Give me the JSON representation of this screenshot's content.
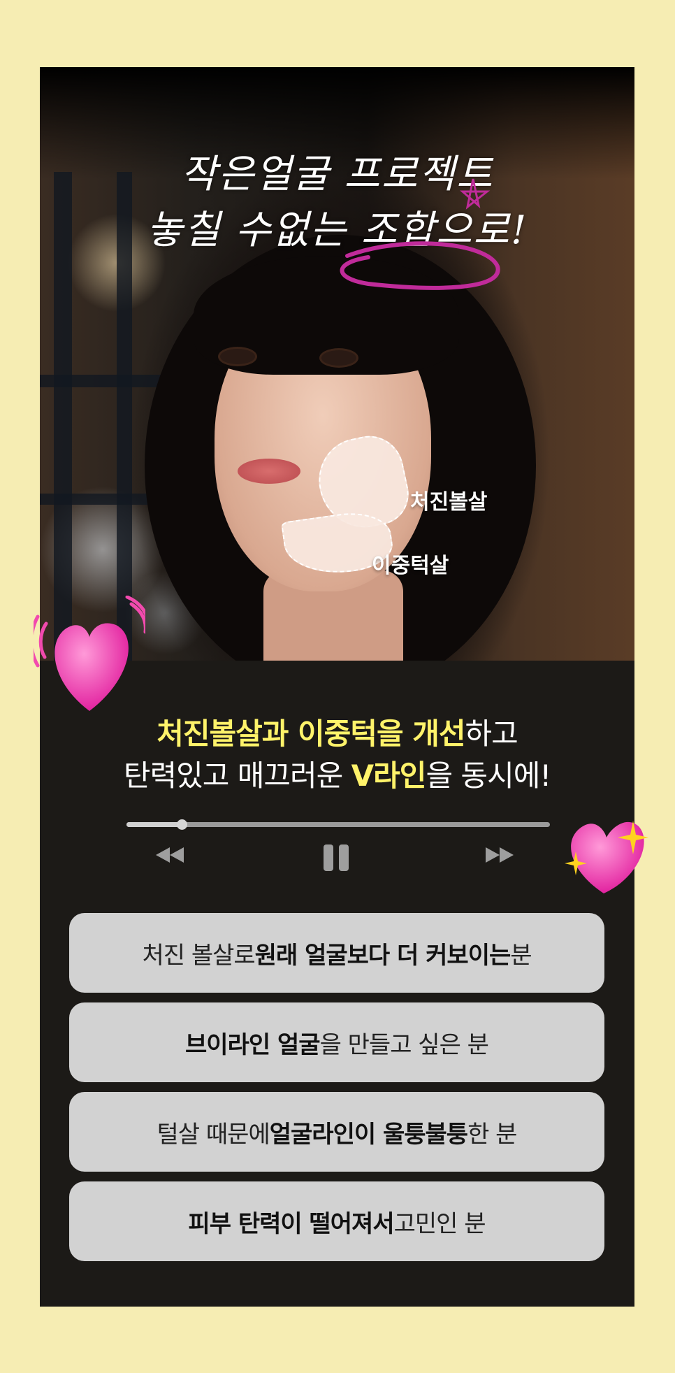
{
  "hero": {
    "title_line1": "작은얼굴 프로젝트",
    "title_line2": "놓칠 수없는 조합으로!",
    "label_cheek": "처진볼살",
    "label_chin": "이중턱살"
  },
  "headline": {
    "line1_hl": "처진볼살과 이중턱을 개선",
    "line1_rest": "하고",
    "line2_a": "탄력있고 매끄러운 ",
    "line2_hl": "V라인",
    "line2_b": "을 동시에!"
  },
  "player": {
    "progress": 0.13,
    "rewind_icon": "rewind-icon",
    "pause_icon": "pause-icon",
    "forward_icon": "fast-forward-icon"
  },
  "targets": [
    {
      "a": "처진 볼살로 ",
      "b": "원래 얼굴보다 더 커보이는",
      "c": " 분"
    },
    {
      "a": "",
      "b": "브이라인 얼굴",
      "c": "을 만들고 싶은 분"
    },
    {
      "a": "털살 때문에 ",
      "b": "얼굴라인이 울퉁불퉁",
      "c": "한 분"
    },
    {
      "a": "",
      "b": "피부 탄력이 떨어져서",
      "c": " 고민인 분"
    }
  ],
  "colors": {
    "background": "#f6edb3",
    "card": "#1c1a17",
    "highlight": "#fff36a",
    "pill": "#d2d2d2",
    "heart": "#ff3fb4"
  }
}
